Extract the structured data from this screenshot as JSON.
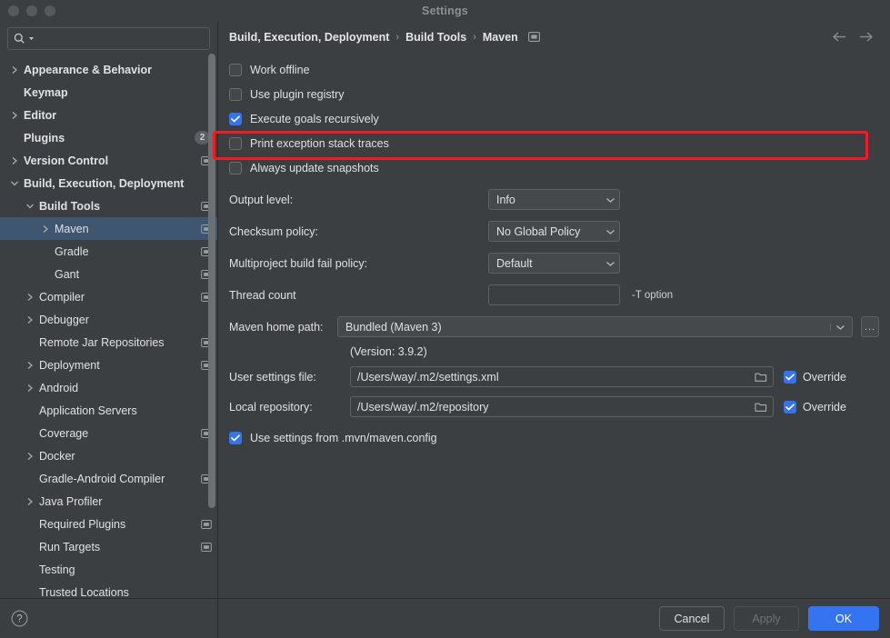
{
  "window": {
    "title": "Settings",
    "traffic_lights": [
      "close",
      "minimize",
      "zoom"
    ]
  },
  "sidebar": {
    "search": {
      "value": "",
      "placeholder": ""
    },
    "items": [
      {
        "label": "Appearance & Behavior",
        "indent": 0,
        "arrow": "collapsed",
        "bold": true,
        "badge": null,
        "project_icon": false,
        "selected": false
      },
      {
        "label": "Keymap",
        "indent": 0,
        "arrow": "none",
        "bold": true,
        "badge": null,
        "project_icon": false,
        "selected": false
      },
      {
        "label": "Editor",
        "indent": 0,
        "arrow": "collapsed",
        "bold": true,
        "badge": null,
        "project_icon": false,
        "selected": false
      },
      {
        "label": "Plugins",
        "indent": 0,
        "arrow": "none",
        "bold": true,
        "badge": "2",
        "project_icon": false,
        "selected": false
      },
      {
        "label": "Version Control",
        "indent": 0,
        "arrow": "collapsed",
        "bold": true,
        "badge": null,
        "project_icon": true,
        "selected": false
      },
      {
        "label": "Build, Execution, Deployment",
        "indent": 0,
        "arrow": "expanded",
        "bold": true,
        "badge": null,
        "project_icon": false,
        "selected": false
      },
      {
        "label": "Build Tools",
        "indent": 1,
        "arrow": "expanded",
        "bold": true,
        "badge": null,
        "project_icon": true,
        "selected": false
      },
      {
        "label": "Maven",
        "indent": 2,
        "arrow": "collapsed",
        "bold": false,
        "badge": null,
        "project_icon": true,
        "selected": true
      },
      {
        "label": "Gradle",
        "indent": 2,
        "arrow": "none",
        "bold": false,
        "badge": null,
        "project_icon": true,
        "selected": false
      },
      {
        "label": "Gant",
        "indent": 2,
        "arrow": "none",
        "bold": false,
        "badge": null,
        "project_icon": true,
        "selected": false
      },
      {
        "label": "Compiler",
        "indent": 1,
        "arrow": "collapsed",
        "bold": false,
        "badge": null,
        "project_icon": true,
        "selected": false
      },
      {
        "label": "Debugger",
        "indent": 1,
        "arrow": "collapsed",
        "bold": false,
        "badge": null,
        "project_icon": false,
        "selected": false
      },
      {
        "label": "Remote Jar Repositories",
        "indent": 1,
        "arrow": "none",
        "bold": false,
        "badge": null,
        "project_icon": true,
        "selected": false
      },
      {
        "label": "Deployment",
        "indent": 1,
        "arrow": "collapsed",
        "bold": false,
        "badge": null,
        "project_icon": true,
        "selected": false
      },
      {
        "label": "Android",
        "indent": 1,
        "arrow": "collapsed",
        "bold": false,
        "badge": null,
        "project_icon": false,
        "selected": false
      },
      {
        "label": "Application Servers",
        "indent": 1,
        "arrow": "none",
        "bold": false,
        "badge": null,
        "project_icon": false,
        "selected": false
      },
      {
        "label": "Coverage",
        "indent": 1,
        "arrow": "none",
        "bold": false,
        "badge": null,
        "project_icon": true,
        "selected": false
      },
      {
        "label": "Docker",
        "indent": 1,
        "arrow": "collapsed",
        "bold": false,
        "badge": null,
        "project_icon": false,
        "selected": false
      },
      {
        "label": "Gradle-Android Compiler",
        "indent": 1,
        "arrow": "none",
        "bold": false,
        "badge": null,
        "project_icon": true,
        "selected": false
      },
      {
        "label": "Java Profiler",
        "indent": 1,
        "arrow": "collapsed",
        "bold": false,
        "badge": null,
        "project_icon": false,
        "selected": false
      },
      {
        "label": "Required Plugins",
        "indent": 1,
        "arrow": "none",
        "bold": false,
        "badge": null,
        "project_icon": true,
        "selected": false
      },
      {
        "label": "Run Targets",
        "indent": 1,
        "arrow": "none",
        "bold": false,
        "badge": null,
        "project_icon": true,
        "selected": false
      },
      {
        "label": "Testing",
        "indent": 1,
        "arrow": "none",
        "bold": false,
        "badge": null,
        "project_icon": false,
        "selected": false
      },
      {
        "label": "Trusted Locations",
        "indent": 1,
        "arrow": "none",
        "bold": false,
        "badge": null,
        "project_icon": false,
        "selected": false
      }
    ],
    "help_label": "?"
  },
  "main": {
    "breadcrumb": [
      "Build, Execution, Deployment",
      "Build Tools",
      "Maven"
    ],
    "breadcrumb_separator": "›",
    "nav_back": "back",
    "nav_forward": "forward",
    "checkboxes": [
      {
        "label": "Work offline",
        "checked": false
      },
      {
        "label": "Use plugin registry",
        "checked": false
      },
      {
        "label": "Execute goals recursively",
        "checked": true
      },
      {
        "label": "Print exception stack traces",
        "checked": false
      },
      {
        "label": "Always update snapshots",
        "checked": false
      }
    ],
    "output_level": {
      "label": "Output level:",
      "value": "Info"
    },
    "checksum_policy": {
      "label": "Checksum policy:",
      "value": "No Global Policy"
    },
    "multiproject_policy": {
      "label": "Multiproject build fail policy:",
      "value": "Default"
    },
    "thread_count": {
      "label": "Thread count",
      "value": "",
      "hint": "-T option"
    },
    "maven_home": {
      "label": "Maven home path:",
      "value": "Bundled (Maven 3)",
      "browse": "...",
      "version": "(Version: 3.9.2)"
    },
    "user_settings": {
      "label": "User settings file:",
      "value": "/Users/way/.m2/settings.xml",
      "override_label": "Override",
      "override_checked": true
    },
    "local_repository": {
      "label": "Local repository:",
      "value": "/Users/way/.m2/repository",
      "override_label": "Override",
      "override_checked": true
    },
    "use_mvn_config": {
      "label": "Use settings from .mvn/maven.config",
      "checked": true
    },
    "highlight_color": "#ee1c25"
  },
  "footer": {
    "cancel": "Cancel",
    "apply": "Apply",
    "ok": "OK"
  },
  "colors": {
    "accent": "#3574f0",
    "selection": "#3f5670",
    "background": "#3c3f41",
    "highlight": "#ee1c25"
  }
}
